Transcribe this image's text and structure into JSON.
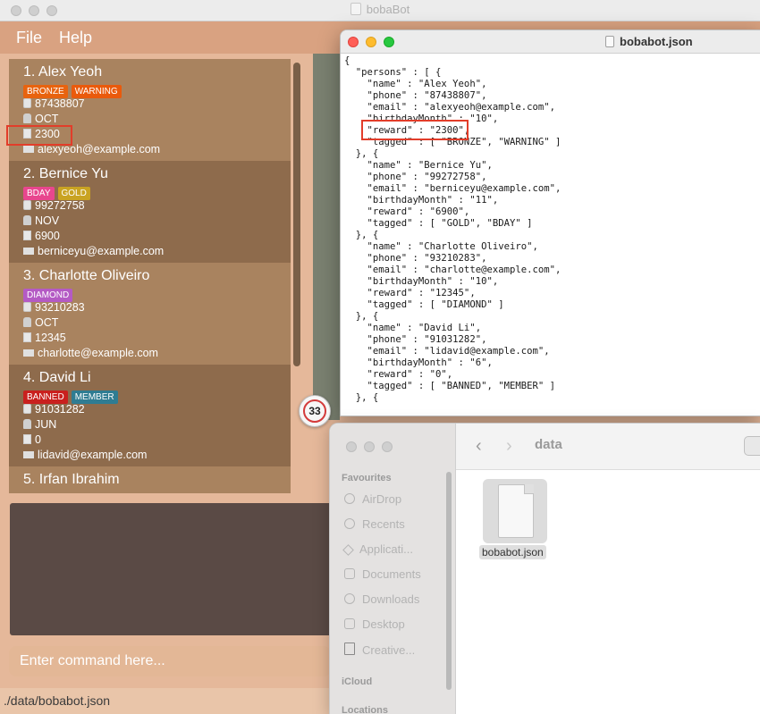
{
  "main_window": {
    "title": "bobaBot",
    "menu": [
      "File",
      "Help"
    ]
  },
  "persons": [
    {
      "index_name": "1.  Alex Yeoh",
      "tags": [
        {
          "label": "BRONZE",
          "color": "#e8630f"
        },
        {
          "label": "WARNING",
          "color": "#ea5a0c"
        }
      ],
      "phone": "87438807",
      "month": "OCT",
      "reward": "2300",
      "email": "alexyeoh@example.com"
    },
    {
      "index_name": "2.  Bernice Yu",
      "tags": [
        {
          "label": "BDAY",
          "color": "#e8468e"
        },
        {
          "label": "GOLD",
          "color": "#c9a322"
        }
      ],
      "phone": "99272758",
      "month": "NOV",
      "reward": "6900",
      "email": "berniceyu@example.com"
    },
    {
      "index_name": "3.  Charlotte Oliveiro",
      "tags": [
        {
          "label": "DIAMOND",
          "color": "#b45ac4"
        }
      ],
      "phone": "93210283",
      "month": "OCT",
      "reward": "12345",
      "email": "charlotte@example.com"
    },
    {
      "index_name": "4.  David Li",
      "tags": [
        {
          "label": "BANNED",
          "color": "#c9201e"
        },
        {
          "label": "MEMBER",
          "color": "#2f7c92"
        }
      ],
      "phone": "91031282",
      "month": "JUN",
      "reward": "0",
      "email": "lidavid@example.com"
    },
    {
      "index_name": "5.  Irfan Ibrahim"
    }
  ],
  "command_placeholder": "Enter command here...",
  "status_path": "./data/bobabot.json",
  "badge_count": "33",
  "json_window": {
    "title": "bobabot.json",
    "lines": [
      "{",
      "  \"persons\" : [ {",
      "    \"name\" : \"Alex Yeoh\",",
      "    \"phone\" : \"87438807\",",
      "    \"email\" : \"alexyeoh@example.com\",",
      "    \"birthdayMonth\" : \"10\",",
      "    \"reward\" : \"2300\",",
      "    \"tagged\" : [ \"BRONZE\", \"WARNING\" ]",
      "  }, {",
      "    \"name\" : \"Bernice Yu\",",
      "    \"phone\" : \"99272758\",",
      "    \"email\" : \"berniceyu@example.com\",",
      "    \"birthdayMonth\" : \"11\",",
      "    \"reward\" : \"6900\",",
      "    \"tagged\" : [ \"GOLD\", \"BDAY\" ]",
      "  }, {",
      "    \"name\" : \"Charlotte Oliveiro\",",
      "    \"phone\" : \"93210283\",",
      "    \"email\" : \"charlotte@example.com\",",
      "    \"birthdayMonth\" : \"10\",",
      "    \"reward\" : \"12345\",",
      "    \"tagged\" : [ \"DIAMOND\" ]",
      "  }, {",
      "    \"name\" : \"David Li\",",
      "    \"phone\" : \"91031282\",",
      "    \"email\" : \"lidavid@example.com\",",
      "    \"birthdayMonth\" : \"6\",",
      "    \"reward\" : \"0\",",
      "    \"tagged\" : [ \"BANNED\", \"MEMBER\" ]",
      "  }, {"
    ]
  },
  "finder": {
    "title": "data",
    "sidebar_headings": {
      "favourites": "Favourites",
      "icloud": "iCloud",
      "locations": "Locations"
    },
    "favourites": [
      {
        "label": "AirDrop",
        "icon": "airdrop-icon"
      },
      {
        "label": "Recents",
        "icon": "clock-icon"
      },
      {
        "label": "Applicati...",
        "icon": "applications-icon"
      },
      {
        "label": "Documents",
        "icon": "document-icon"
      },
      {
        "label": "Downloads",
        "icon": "download-icon"
      },
      {
        "label": "Desktop",
        "icon": "desktop-icon"
      },
      {
        "label": "Creative...",
        "icon": "file-icon"
      }
    ],
    "file_name": "bobabot.json"
  }
}
